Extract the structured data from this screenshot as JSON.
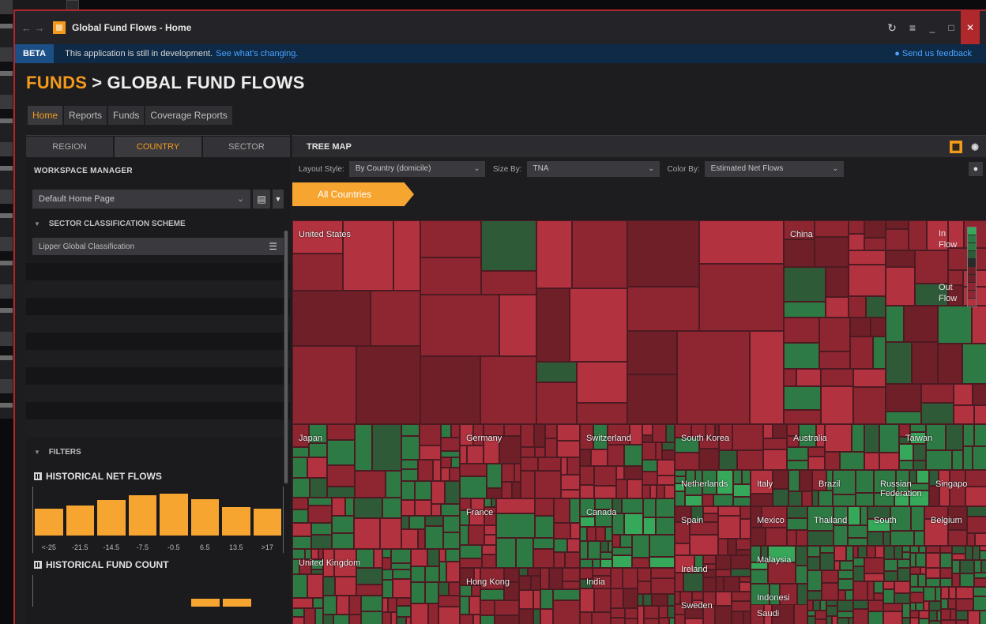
{
  "window": {
    "title": "Global Fund Flows - Home",
    "nav_glyph": "← →",
    "refresh_glyph": "↻",
    "menu_glyph": "≡",
    "minimize_glyph": "_",
    "maximize_glyph": "□",
    "close_glyph": "✕"
  },
  "beta_bar": {
    "badge": "BETA",
    "message": "This application is still in development.",
    "link": "See what's changing.",
    "feedback": "● Send us feedback"
  },
  "header": {
    "root": "FUNDS",
    "separator": ">",
    "current": "GLOBAL FUND FLOWS"
  },
  "top_tabs": [
    {
      "label": "Home",
      "active": true
    },
    {
      "label": "Reports",
      "active": false
    },
    {
      "label": "Funds",
      "active": false
    },
    {
      "label": "Coverage Reports",
      "active": false
    }
  ],
  "left_panel": {
    "view_toggle": [
      {
        "label": "REGION",
        "active": false
      },
      {
        "label": "COUNTRY",
        "active": true
      },
      {
        "label": "SECTOR",
        "active": false
      }
    ],
    "workspace_title": "WORKSPACE MANAGER",
    "workspace_value": "Default Home Page",
    "sector_section": "SECTOR CLASSIFICATION SCHEME",
    "classification_value": "Lipper Global Classification",
    "filters_section": "FILTERS",
    "net_flows_title": "HISTORICAL NET FLOWS",
    "net_flows_bins": [
      "<-25",
      "-21.5",
      "-14.5",
      "-7.5",
      "-0.5",
      "6.5",
      "13.5",
      ">17"
    ],
    "net_flows_levels": [
      0.55,
      0.62,
      0.72,
      0.82,
      0.85,
      0.74,
      0.58,
      0.55
    ],
    "fund_count_title": "HISTORICAL FUND COUNT"
  },
  "treemap": {
    "panel_title": "TREE MAP",
    "layout_label": "Layout Style:",
    "layout_value": "By Country (domicile)",
    "size_label": "Size By:",
    "size_value": "TNA",
    "color_label": "Color By:",
    "color_value": "Estimated Net Flows",
    "breadcrumb": "All Countries",
    "legend_in": "In\nFlow",
    "legend_out": "Out\nFlow",
    "colors": {
      "strong_out": "#b3323f",
      "mid_out": "#8e2632",
      "weak_out": "#6e1f28",
      "weak_in": "#2f5a37",
      "mid_in": "#2e7a44",
      "strong_in": "#36a85a"
    },
    "countries": [
      {
        "name": "United States"
      },
      {
        "name": "China"
      },
      {
        "name": "Japan"
      },
      {
        "name": "Germany"
      },
      {
        "name": "Switzerland"
      },
      {
        "name": "South Korea"
      },
      {
        "name": "Australia"
      },
      {
        "name": "Taiwan"
      },
      {
        "name": "Netherlands"
      },
      {
        "name": "Italy"
      },
      {
        "name": "Brazil"
      },
      {
        "name": "Russian Federation"
      },
      {
        "name": "Singapo"
      },
      {
        "name": "France"
      },
      {
        "name": "Canada"
      },
      {
        "name": "Spain"
      },
      {
        "name": "Mexico"
      },
      {
        "name": "Thailand"
      },
      {
        "name": "South"
      },
      {
        "name": "Belgium"
      },
      {
        "name": "Malaysia"
      },
      {
        "name": "Ireland"
      },
      {
        "name": "Indonesi"
      },
      {
        "name": "United Kingdom"
      },
      {
        "name": "Hong Kong"
      },
      {
        "name": "India"
      },
      {
        "name": "Sweden"
      },
      {
        "name": "Saudi"
      }
    ]
  }
}
